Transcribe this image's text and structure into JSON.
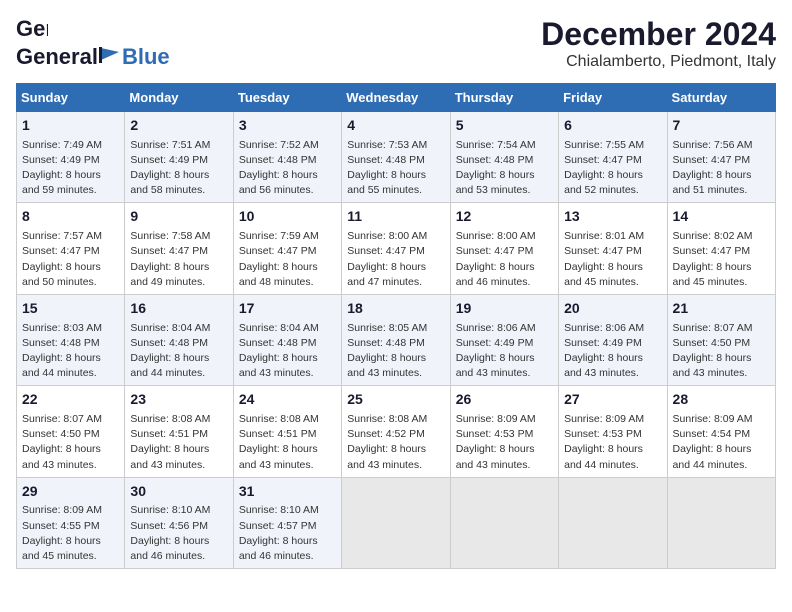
{
  "header": {
    "logo_general": "General",
    "logo_blue": "Blue",
    "month_title": "December 2024",
    "location": "Chialamberto, Piedmont, Italy"
  },
  "weekdays": [
    "Sunday",
    "Monday",
    "Tuesday",
    "Wednesday",
    "Thursday",
    "Friday",
    "Saturday"
  ],
  "weeks": [
    [
      {
        "day": "1",
        "info": "Sunrise: 7:49 AM\nSunset: 4:49 PM\nDaylight: 8 hours\nand 59 minutes."
      },
      {
        "day": "2",
        "info": "Sunrise: 7:51 AM\nSunset: 4:49 PM\nDaylight: 8 hours\nand 58 minutes."
      },
      {
        "day": "3",
        "info": "Sunrise: 7:52 AM\nSunset: 4:48 PM\nDaylight: 8 hours\nand 56 minutes."
      },
      {
        "day": "4",
        "info": "Sunrise: 7:53 AM\nSunset: 4:48 PM\nDaylight: 8 hours\nand 55 minutes."
      },
      {
        "day": "5",
        "info": "Sunrise: 7:54 AM\nSunset: 4:48 PM\nDaylight: 8 hours\nand 53 minutes."
      },
      {
        "day": "6",
        "info": "Sunrise: 7:55 AM\nSunset: 4:47 PM\nDaylight: 8 hours\nand 52 minutes."
      },
      {
        "day": "7",
        "info": "Sunrise: 7:56 AM\nSunset: 4:47 PM\nDaylight: 8 hours\nand 51 minutes."
      }
    ],
    [
      {
        "day": "8",
        "info": "Sunrise: 7:57 AM\nSunset: 4:47 PM\nDaylight: 8 hours\nand 50 minutes."
      },
      {
        "day": "9",
        "info": "Sunrise: 7:58 AM\nSunset: 4:47 PM\nDaylight: 8 hours\nand 49 minutes."
      },
      {
        "day": "10",
        "info": "Sunrise: 7:59 AM\nSunset: 4:47 PM\nDaylight: 8 hours\nand 48 minutes."
      },
      {
        "day": "11",
        "info": "Sunrise: 8:00 AM\nSunset: 4:47 PM\nDaylight: 8 hours\nand 47 minutes."
      },
      {
        "day": "12",
        "info": "Sunrise: 8:00 AM\nSunset: 4:47 PM\nDaylight: 8 hours\nand 46 minutes."
      },
      {
        "day": "13",
        "info": "Sunrise: 8:01 AM\nSunset: 4:47 PM\nDaylight: 8 hours\nand 45 minutes."
      },
      {
        "day": "14",
        "info": "Sunrise: 8:02 AM\nSunset: 4:47 PM\nDaylight: 8 hours\nand 45 minutes."
      }
    ],
    [
      {
        "day": "15",
        "info": "Sunrise: 8:03 AM\nSunset: 4:48 PM\nDaylight: 8 hours\nand 44 minutes."
      },
      {
        "day": "16",
        "info": "Sunrise: 8:04 AM\nSunset: 4:48 PM\nDaylight: 8 hours\nand 44 minutes."
      },
      {
        "day": "17",
        "info": "Sunrise: 8:04 AM\nSunset: 4:48 PM\nDaylight: 8 hours\nand 43 minutes."
      },
      {
        "day": "18",
        "info": "Sunrise: 8:05 AM\nSunset: 4:48 PM\nDaylight: 8 hours\nand 43 minutes."
      },
      {
        "day": "19",
        "info": "Sunrise: 8:06 AM\nSunset: 4:49 PM\nDaylight: 8 hours\nand 43 minutes."
      },
      {
        "day": "20",
        "info": "Sunrise: 8:06 AM\nSunset: 4:49 PM\nDaylight: 8 hours\nand 43 minutes."
      },
      {
        "day": "21",
        "info": "Sunrise: 8:07 AM\nSunset: 4:50 PM\nDaylight: 8 hours\nand 43 minutes."
      }
    ],
    [
      {
        "day": "22",
        "info": "Sunrise: 8:07 AM\nSunset: 4:50 PM\nDaylight: 8 hours\nand 43 minutes."
      },
      {
        "day": "23",
        "info": "Sunrise: 8:08 AM\nSunset: 4:51 PM\nDaylight: 8 hours\nand 43 minutes."
      },
      {
        "day": "24",
        "info": "Sunrise: 8:08 AM\nSunset: 4:51 PM\nDaylight: 8 hours\nand 43 minutes."
      },
      {
        "day": "25",
        "info": "Sunrise: 8:08 AM\nSunset: 4:52 PM\nDaylight: 8 hours\nand 43 minutes."
      },
      {
        "day": "26",
        "info": "Sunrise: 8:09 AM\nSunset: 4:53 PM\nDaylight: 8 hours\nand 43 minutes."
      },
      {
        "day": "27",
        "info": "Sunrise: 8:09 AM\nSunset: 4:53 PM\nDaylight: 8 hours\nand 44 minutes."
      },
      {
        "day": "28",
        "info": "Sunrise: 8:09 AM\nSunset: 4:54 PM\nDaylight: 8 hours\nand 44 minutes."
      }
    ],
    [
      {
        "day": "29",
        "info": "Sunrise: 8:09 AM\nSunset: 4:55 PM\nDaylight: 8 hours\nand 45 minutes."
      },
      {
        "day": "30",
        "info": "Sunrise: 8:10 AM\nSunset: 4:56 PM\nDaylight: 8 hours\nand 46 minutes."
      },
      {
        "day": "31",
        "info": "Sunrise: 8:10 AM\nSunset: 4:57 PM\nDaylight: 8 hours\nand 46 minutes."
      },
      null,
      null,
      null,
      null
    ]
  ]
}
